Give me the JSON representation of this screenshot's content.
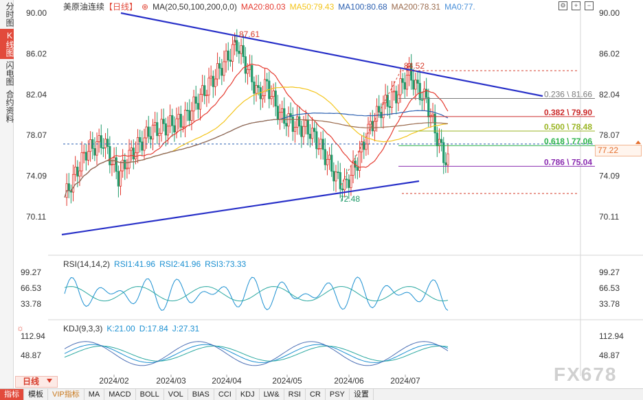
{
  "left_tabs": [
    {
      "label": "分时图",
      "active": false
    },
    {
      "label": "K线图",
      "active": true
    },
    {
      "label": "闪电图",
      "active": false
    },
    {
      "label": "合约资料",
      "active": false
    }
  ],
  "header": {
    "instrument": "美原油连续",
    "period": "【日线】",
    "ma_title": "MA(20,50,100,200,0,0)",
    "ma20": "MA20:80.03",
    "ma50": "MA50:79.43",
    "ma100": "MA100:80.68",
    "ma200": "MA200:78.31",
    "ma_extra": "MA0:77."
  },
  "colors": {
    "ma20": "#e53a2f",
    "ma50": "#f3c419",
    "ma100": "#2a5fb0",
    "ma200": "#9a6a4c",
    "up": "#e2332a",
    "down": "#1f9a6a",
    "trend": "#2830c8"
  },
  "price_axis": {
    "labels": [
      "90.00",
      "86.02",
      "82.04",
      "78.07",
      "74.09",
      "70.11"
    ],
    "values": [
      90.0,
      86.02,
      82.04,
      78.07,
      74.09,
      70.11
    ]
  },
  "annotations": {
    "high": "87.61",
    "mid_high": "84.52",
    "low": "72.48",
    "current_price": "77.22"
  },
  "fib_levels": [
    {
      "label": "0.236 \\ 81.66",
      "value": 81.66,
      "color": "#7a7a7a"
    },
    {
      "label": "0.382 \\ 79.90",
      "value": 79.9,
      "color": "#cc2b2b"
    },
    {
      "label": "0.500 \\ 78.48",
      "value": 78.48,
      "color": "#9ab523"
    },
    {
      "label": "0.618 \\ 77.06",
      "value": 77.06,
      "color": "#2bb34a"
    },
    {
      "label": "0.786 \\ 75.04",
      "value": 75.04,
      "color": "#8a2bb0"
    }
  ],
  "rsi": {
    "title": "RSI(14,14,2)",
    "rsi1": "RSI1:41.96",
    "rsi2": "RSI2:41.96",
    "rsi3": "RSI3:73.33",
    "axis_labels": [
      "99.27",
      "66.53",
      "33.78"
    ]
  },
  "kdj": {
    "title": "KDJ(9,3,3)",
    "k": "K:21.00",
    "d": "D:17.84",
    "j": "J:27.31",
    "axis_labels": [
      "112.94",
      "48.87"
    ]
  },
  "time_axis": [
    "2024/02",
    "2024/03",
    "2024/04",
    "2024/05",
    "2024/06",
    "2024/07"
  ],
  "period_label": "日线",
  "bottom_bar": [
    "指标",
    "模板",
    "VIP指标",
    "MA",
    "MACD",
    "BOLL",
    "VOL",
    "BIAS",
    "CCI",
    "KDJ",
    "LW&",
    "RSI",
    "CR",
    "PSY",
    "设置"
  ],
  "watermark": "FX678"
}
